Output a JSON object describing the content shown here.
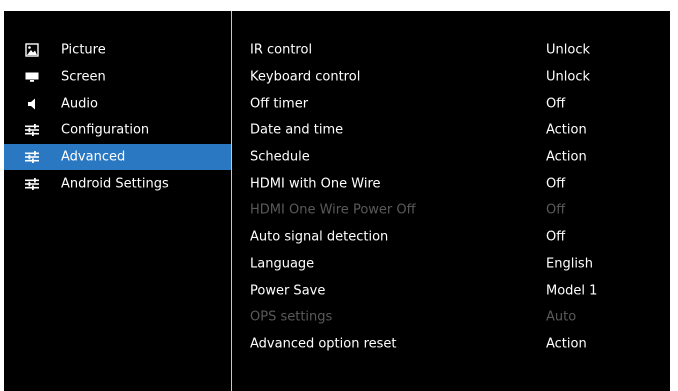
{
  "menu": {
    "items": [
      {
        "label": "Picture",
        "icon": "picture-icon",
        "selected": false
      },
      {
        "label": "Screen",
        "icon": "screen-icon",
        "selected": false
      },
      {
        "label": "Audio",
        "icon": "audio-icon",
        "selected": false
      },
      {
        "label": "Configuration",
        "icon": "sliders-icon",
        "selected": false
      },
      {
        "label": "Advanced",
        "icon": "sliders-icon",
        "selected": true
      },
      {
        "label": "Android Settings",
        "icon": "sliders-icon",
        "selected": false
      }
    ]
  },
  "settings": {
    "rows": [
      {
        "label": "IR control",
        "value": "Unlock",
        "enabled": true
      },
      {
        "label": "Keyboard control",
        "value": "Unlock",
        "enabled": true
      },
      {
        "label": "Off timer",
        "value": "Off",
        "enabled": true
      },
      {
        "label": "Date and time",
        "value": "Action",
        "enabled": true
      },
      {
        "label": "Schedule",
        "value": "Action",
        "enabled": true
      },
      {
        "label": "HDMI with One Wire",
        "value": "Off",
        "enabled": true
      },
      {
        "label": "HDMI One Wire Power Off",
        "value": "Off",
        "enabled": false
      },
      {
        "label": "Auto signal detection",
        "value": "Off",
        "enabled": true
      },
      {
        "label": "Language",
        "value": "English",
        "enabled": true
      },
      {
        "label": "Power Save",
        "value": "Model 1",
        "enabled": true
      },
      {
        "label": "OPS settings",
        "value": "Auto",
        "enabled": false
      },
      {
        "label": "Advanced option reset",
        "value": "Action",
        "enabled": true
      }
    ]
  },
  "colors": {
    "background": "#000000",
    "selected_highlight": "#2b78c2",
    "text": "#ffffff",
    "disabled_text": "#5a5a5a",
    "divider": "#c8c8c8"
  }
}
